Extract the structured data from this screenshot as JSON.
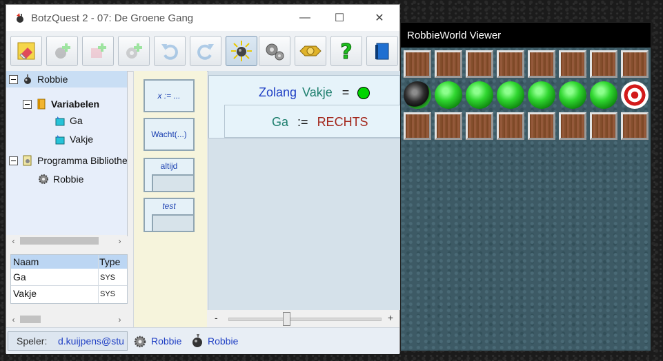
{
  "window": {
    "title": "BotzQuest 2 - 07: De Groene Gang",
    "controls": {
      "minimize": "—",
      "maximize": "☐",
      "close": "✕"
    }
  },
  "toolbar": {
    "buttons": [
      {
        "name": "eraser-button",
        "icon": "eraser-icon",
        "state": "normal"
      },
      {
        "name": "add-robot-button",
        "icon": "add-robot-icon",
        "state": "disabled"
      },
      {
        "name": "add-variable-button",
        "icon": "add-variable-icon",
        "state": "disabled"
      },
      {
        "name": "add-procedure-button",
        "icon": "add-gear-icon",
        "state": "disabled"
      },
      {
        "name": "undo-button",
        "icon": "undo-icon",
        "state": "disabled"
      },
      {
        "name": "redo-button",
        "icon": "redo-icon",
        "state": "disabled"
      },
      {
        "name": "run-robot-button",
        "icon": "robot-sparkle-icon",
        "state": "active"
      },
      {
        "name": "settings-button",
        "icon": "gears-icon",
        "state": "normal"
      },
      {
        "name": "badge-button",
        "icon": "gold-badge-icon",
        "state": "normal"
      },
      {
        "name": "help-button",
        "icon": "question-mark-icon",
        "state": "normal"
      },
      {
        "name": "book-button",
        "icon": "book-icon",
        "state": "normal"
      }
    ]
  },
  "tree": {
    "items": [
      {
        "label": "Robbie",
        "bold": false
      },
      {
        "label": "Variabelen",
        "bold": true
      },
      {
        "label": "Ga",
        "bold": false
      },
      {
        "label": "Vakje",
        "bold": false
      },
      {
        "label": "Programma Bibliotheek",
        "bold": false
      },
      {
        "label": "Robbie",
        "bold": false
      }
    ]
  },
  "variables_table": {
    "headers": [
      "Naam",
      "Type"
    ],
    "rows": [
      [
        "Ga",
        "SYS"
      ],
      [
        "Vakje",
        "SYS"
      ]
    ]
  },
  "palette": {
    "blocks": [
      {
        "label": "x := ..."
      },
      {
        "label": "Wacht(...)"
      },
      {
        "label": "altijd"
      },
      {
        "label": "test"
      }
    ]
  },
  "editor": {
    "while_keyword": "Zolang",
    "while_var": "Vakje",
    "while_op": "=",
    "assign_var": "Ga",
    "assign_op": ":=",
    "assign_value": "RECHTS",
    "colors": {
      "keyword": "#1f3fc4",
      "variable": "#1e7f6e",
      "value": "#a3261b",
      "green": "#00d400"
    }
  },
  "zoom_slider": {
    "minus": "-",
    "plus": "+",
    "level": 0.38
  },
  "statusbar": {
    "player_label": "Speler:",
    "player_value": "d.kuijpens@stu",
    "program_label": "Robbie",
    "robot_label": "Robbie"
  },
  "viewer": {
    "title": "RobbieWorld Viewer",
    "rows": [
      [
        "wall",
        "wall",
        "wall",
        "wall",
        "wall",
        "wall",
        "wall",
        "wall"
      ],
      [
        "robot",
        "gem",
        "gem",
        "gem",
        "gem",
        "gem",
        "gem",
        "target"
      ],
      [
        "wall",
        "wall",
        "wall",
        "wall",
        "wall",
        "wall",
        "wall",
        "wall"
      ]
    ]
  }
}
